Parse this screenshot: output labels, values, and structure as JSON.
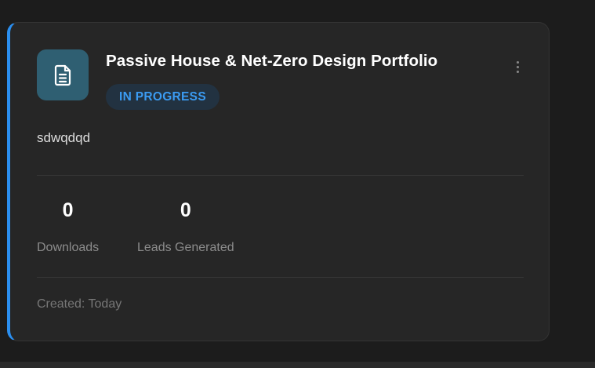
{
  "card": {
    "title": "Passive House & Net-Zero Design Portfolio",
    "status": "IN PROGRESS",
    "description": "sdwqdqd",
    "stats": [
      {
        "value": "0",
        "label": "Downloads"
      },
      {
        "value": "0",
        "label": "Leads Generated"
      }
    ],
    "created": "Created: Today"
  },
  "icons": {
    "document": "document-icon",
    "more": "more-vertical-icon"
  },
  "colors": {
    "page_background": "#1c1c1c",
    "card_background": "#262626",
    "accent": "#2b8ff0",
    "icon_tile": "#2f5f72",
    "badge_background": "#223241",
    "badge_text": "#3b9bf2"
  }
}
